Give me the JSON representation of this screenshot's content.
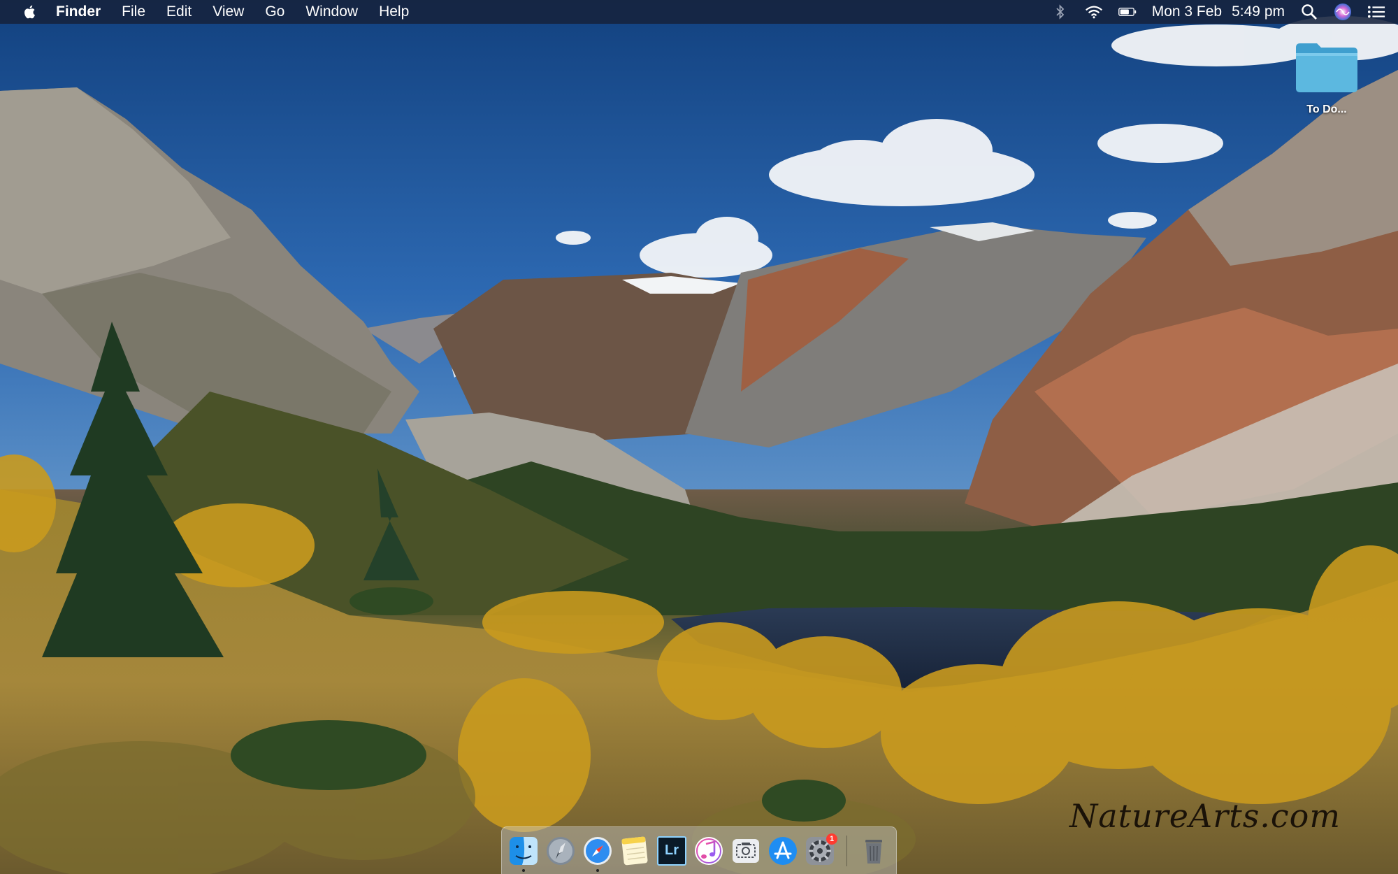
{
  "menubar": {
    "app_name": "Finder",
    "menus": [
      "File",
      "Edit",
      "View",
      "Go",
      "Window",
      "Help"
    ],
    "status": {
      "date": "Mon 3 Feb",
      "time": "5:49 pm"
    },
    "icons": [
      "apple-icon",
      "bluetooth-icon",
      "wifi-icon",
      "battery-icon",
      "spotlight-icon",
      "siri-icon",
      "notification-center-icon"
    ]
  },
  "desktop": {
    "folder_label": "To Do..."
  },
  "watermark": {
    "text": "NatureArts.com"
  },
  "dock": {
    "items": [
      {
        "name": "finder",
        "icon": "finder-icon",
        "running": true
      },
      {
        "name": "launchpad",
        "icon": "launchpad-icon",
        "running": false
      },
      {
        "name": "safari",
        "icon": "safari-icon",
        "running": true
      },
      {
        "name": "notes",
        "icon": "notes-icon",
        "running": false
      },
      {
        "name": "lightroom",
        "icon": "lightroom-icon",
        "label": "Lr",
        "running": false
      },
      {
        "name": "itunes",
        "icon": "itunes-icon",
        "running": false
      },
      {
        "name": "screenshot",
        "icon": "screenshot-icon",
        "running": false
      },
      {
        "name": "app-store",
        "icon": "app-store-icon",
        "running": false
      },
      {
        "name": "system-preferences",
        "icon": "system-preferences-icon",
        "badge": "1",
        "running": false
      },
      {
        "name": "trash",
        "icon": "trash-icon",
        "running": false
      }
    ]
  },
  "colors": {
    "menubar_bg": "#16223c",
    "sky": "#2a66b0",
    "folder_blue": "#5ab4dc",
    "badge_red": "#ff3b30"
  }
}
